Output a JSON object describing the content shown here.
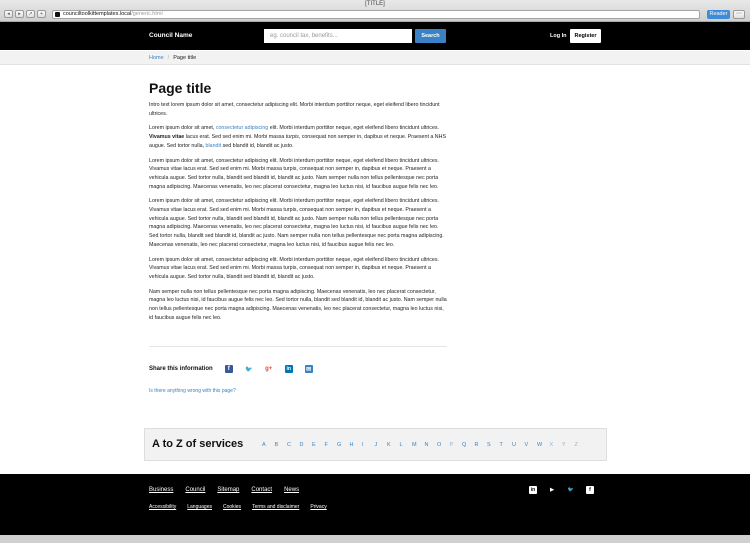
{
  "browser": {
    "window_title": "[TITLE]",
    "url_host": "counciltoolkittemplates.local",
    "url_path": "/generic.html",
    "reader_label": "Reader"
  },
  "header": {
    "brand": "Council Name",
    "search_placeholder": "eg. council tax, benefits...",
    "search_button": "Search",
    "login": "Log In",
    "register": "Register"
  },
  "breadcrumb": {
    "home": "Home",
    "current": "Page title"
  },
  "main": {
    "title": "Page title",
    "intro": "Intro text lorem ipsum dolor sit amet, consectetur adipiscing elit. Morbi interdum porttitor neque, eget eleifend libero tincidunt ultrices.",
    "p2": {
      "a": "Lorem ipsum dolor sit amet, ",
      "link1": "consectetur adipiscing",
      "b": " elit. Morbi interdum porttitor neque, eget eleifend libero tincidunt ultrices. ",
      "bold": "Vivamus vitae",
      "c": " lacus erat. Sed sed enim mi. Morbi massa ",
      "italic": "turpis",
      "d": ", consequat non semper in, dapibus et neque. Praesent a NHS augue. Sed tortor nulla, ",
      "link2": "blandit",
      "e": " sed blandit id, blandit ac justo."
    },
    "p3": "Lorem ipsum dolor sit amet, consectetur adipiscing elit. Morbi interdum porttitor neque, eget eleifend libero tincidunt ultrices. Vivamus vitae lacus erat. Sed sed enim mi. Morbi massa turpis, consequat non semper in, dapibus et neque. Praesent a vehicula augue. Sed tortor nulla, blandit sed blandit id, blandit ac justo. Nam semper nulla non tellus pellentesque nec porta magna adipiscing. Maecenas venenatis, leo nec placerat consectetur, magna leo luctus nisi, id faucibus augue felis nec leo.",
    "p4": "Lorem ipsum dolor sit amet, consectetur adipiscing elit. Morbi interdum porttitor neque, eget eleifend libero tincidunt ultrices. Vivamus vitae lacus erat. Sed sed enim mi. Morbi massa turpis, consequat non semper in, dapibus et neque. Praesent a vehicula augue. Sed tortor nulla, blandit sed blandit id, blandit ac justo. Nam semper nulla non tellus pellentesque nec porta magna adipiscing. Maecenas venenatis, leo nec placerat consectetur, magna leo luctus nisi, id faucibus augue felis nec leo. Sed tortor nulla, blandit sed blandit id, blandit ac justo. Nam semper nulla non tellus pellentesque nec porta magna adipiscing. Maecenas venenatis, leo nec placerat consectetur, magna leo luctus nisi, id faucibus augue felis nec leo.",
    "p5": "Lorem ipsum dolor sit amet, consectetur adipiscing elit. Morbi interdum porttitor neque, eget eleifend libero tincidunt ultrices. Vivamus vitae lacus erat. Sed sed enim mi. Morbi massa turpis, consequat non semper in, dapibus et neque. Praesent a vehicula augue. Sed tortor nulla, blandit sed blandit id, blandit ac justo.",
    "p6": "Nam semper nulla non tellus pellentesque nec porta magna adipiscing. Maecenas venenatis, leo nec placerat consectetur, magna leo luctus nisi, id faucibus augue felis nec leo. Sed tortor nulla, blandit sed blandit id, blandit ac justo. Nam semper nulla non tellus pellentesque nec porta magna adipiscing. Maecenas venenatis, leo nec placerat consectetur, magna leo luctus nisi, id faucibus augue felis nec leo."
  },
  "share": {
    "label": "Share this information",
    "icons": [
      "facebook-icon",
      "twitter-icon",
      "google-plus-icon",
      "linkedin-icon",
      "email-icon"
    ],
    "wrong_link": "Is there anything wrong with this page?"
  },
  "az": {
    "title": "A to Z of services",
    "letters": [
      "A",
      "B",
      "C",
      "D",
      "E",
      "F",
      "G",
      "H",
      "I",
      "J",
      "K",
      "L",
      "M",
      "N",
      "O",
      "P",
      "Q",
      "R",
      "S",
      "T",
      "U",
      "V",
      "W",
      "X",
      "Y",
      "Z"
    ]
  },
  "footer": {
    "links": [
      "Business",
      "Council",
      "Sitemap",
      "Contact",
      "News"
    ],
    "small_links": [
      "Accessibility",
      "Languages",
      "Cookies",
      "Terms and disclaimer",
      "Privacy"
    ],
    "icons": [
      "linkedin-icon",
      "youtube-icon",
      "twitter-icon",
      "facebook-icon"
    ]
  },
  "colors": {
    "accent": "#3b82c4",
    "header_bg": "#000000",
    "panel_bg": "#f2f2f2"
  }
}
